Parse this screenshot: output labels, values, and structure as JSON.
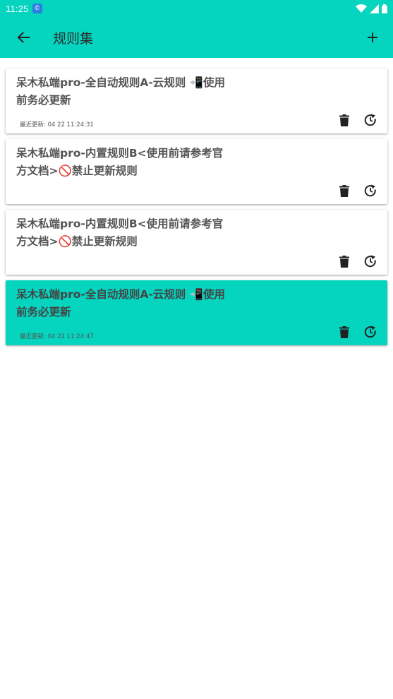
{
  "status_bar": {
    "time": "11:25"
  },
  "app_bar": {
    "title": "规则集"
  },
  "rules": [
    {
      "title": "呆木私端pro-全自动规则A-云规则 📲使用前务必更新",
      "updated": "最近更新: 04 22 11:24:31",
      "selected": false
    },
    {
      "title": "呆木私端pro-内置规则B<使用前请参考官方文档>🚫禁止更新规则",
      "updated": "",
      "selected": false
    },
    {
      "title": "呆木私端pro-内置规则B<使用前请参考官方文档>🚫禁止更新规则",
      "updated": "",
      "selected": false
    },
    {
      "title": "呆木私端pro-全自动规则A-云规则 📲使用前务必更新",
      "updated": "最近更新: 04 22 11:24:47",
      "selected": true
    }
  ],
  "icons": {
    "back": "arrow-back-icon",
    "add": "plus-icon",
    "delete": "trash-icon",
    "update": "refresh-icon",
    "wifi": "wifi-icon",
    "signal": "signal-icon",
    "battery": "battery-icon"
  },
  "colors": {
    "accent": "#05d4bf",
    "text": "#555555"
  }
}
